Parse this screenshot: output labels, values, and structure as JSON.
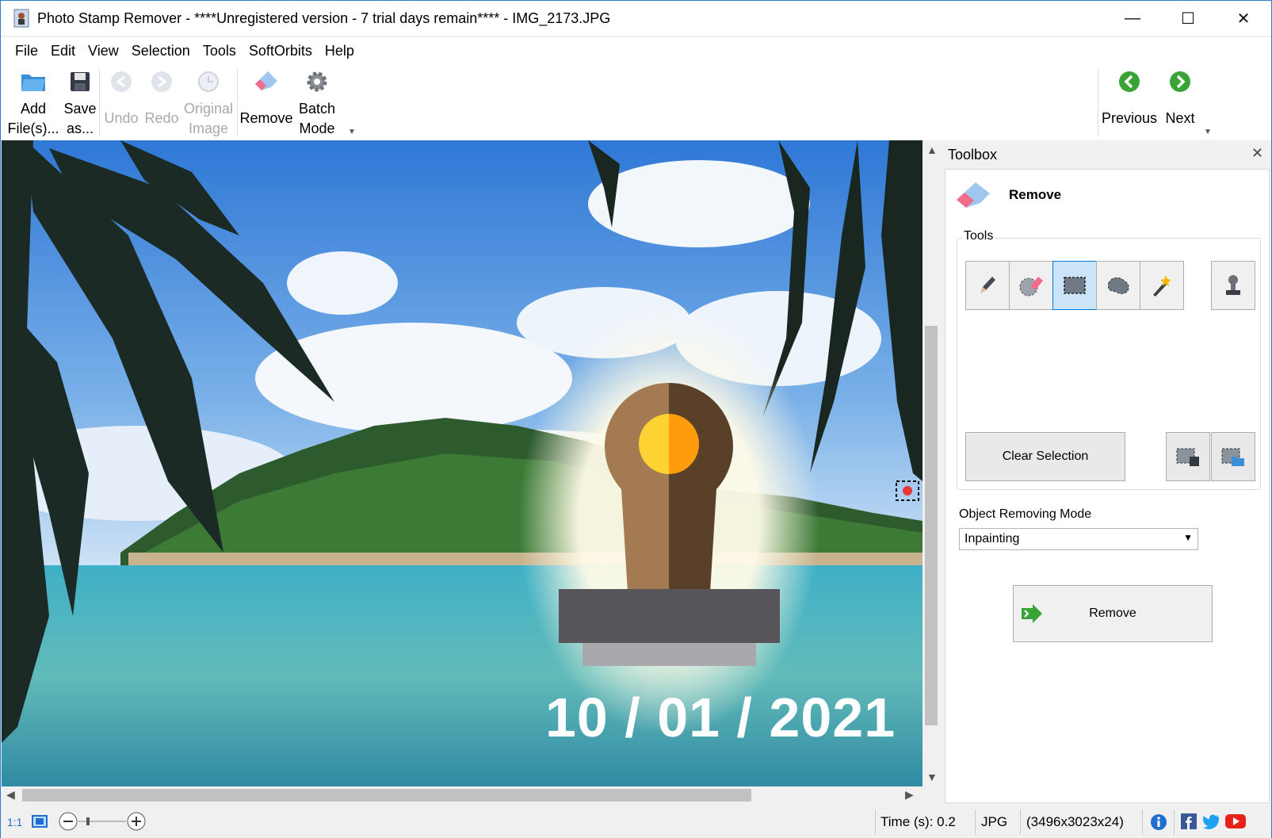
{
  "window": {
    "title": "Photo Stamp Remover - ****Unregistered version - 7 trial days remain**** - IMG_2173.JPG",
    "controls": {
      "minimize": "—",
      "maximize": "☐",
      "close": "✕"
    }
  },
  "menu": [
    {
      "label": "File"
    },
    {
      "label": "Edit"
    },
    {
      "label": "View"
    },
    {
      "label": "Selection"
    },
    {
      "label": "Tools"
    },
    {
      "label": "SoftOrbits"
    },
    {
      "label": "Help"
    }
  ],
  "toolbar": {
    "add_files": {
      "line1": "Add",
      "line2": "File(s)..."
    },
    "save_as": {
      "line1": "Save",
      "line2": "as..."
    },
    "undo": "Undo",
    "redo": "Redo",
    "original_image": {
      "line1": "Original",
      "line2": "Image"
    },
    "remove": "Remove",
    "batch_mode": {
      "line1": "Batch",
      "line2": "Mode"
    },
    "previous": "Previous",
    "next": "Next"
  },
  "image": {
    "date_stamp": "10 / 01 / 2021"
  },
  "toolbox": {
    "title": "Toolbox",
    "close": "✕",
    "section_title": "Remove",
    "tools_label": "Tools",
    "clear_selection": "Clear Selection",
    "mode_label": "Object Removing Mode",
    "mode_value": "Inpainting",
    "remove_button": "Remove"
  },
  "statusbar": {
    "zoom_ratio": "1:1",
    "time": "Time (s): 0.2",
    "format": "JPG",
    "dimensions": "(3496x3023x24)"
  },
  "colors": {
    "accent": "#0078d7",
    "nav_green": "#3aa335",
    "sky": "#4a8fd8",
    "water": "#5ab7c4",
    "stamp_dark": "#5a4029",
    "stamp_light": "#a47a52",
    "stamp_base": "#57555a"
  }
}
